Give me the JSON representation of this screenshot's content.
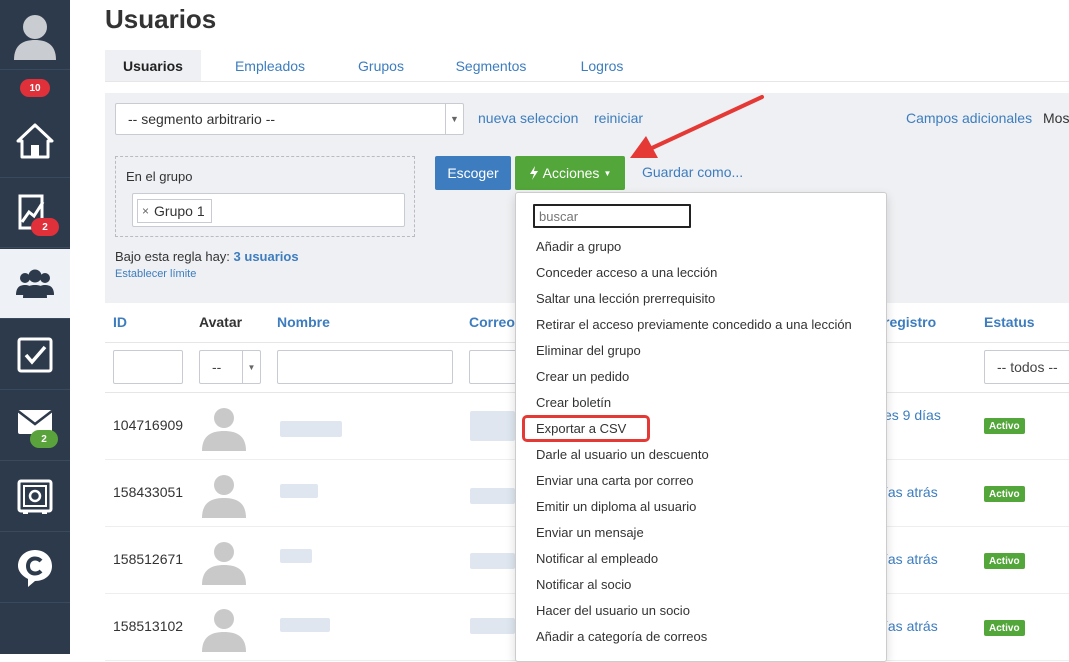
{
  "sidebar": {
    "badges": {
      "notifications": "10",
      "stats": "2",
      "mail": "2"
    }
  },
  "page": {
    "title": "Usuarios"
  },
  "tabs": [
    "Usuarios",
    "Empleados",
    "Grupos",
    "Segmentos",
    "Logros"
  ],
  "filters": {
    "segment_select": "-- segmento arbitrario --",
    "new_selection": "nueva seleccion",
    "reset": "reiniciar",
    "extra_fields": "Campos adicionales",
    "show_more": "Mos",
    "group_label": "En el grupo",
    "group_chip": "Grupo 1",
    "rule_prefix": "Bajo esta regla hay:",
    "rule_count": "3 usuarios",
    "set_limit": "Establecer límite",
    "choose_button": "Escoger",
    "actions_button": "Acciones",
    "save_as": "Guardar como..."
  },
  "table": {
    "headers": {
      "id": "ID",
      "avatar": "Avatar",
      "name": "Nombre",
      "email": "Correo",
      "registered": "registro",
      "status": "Estatus"
    },
    "filter_avatar": "--",
    "filter_status": "-- todos --",
    "rows": [
      {
        "id": "104716909",
        "date": "es 9 días",
        "status": "Activo"
      },
      {
        "id": "158433051",
        "date": "ías atrás",
        "status": "Activo"
      },
      {
        "id": "158512671",
        "date": "ías atrás",
        "status": "Activo"
      },
      {
        "id": "158513102",
        "date": "ías atrás",
        "status": "Activo"
      }
    ]
  },
  "dropdown": {
    "search_placeholder": "buscar",
    "items": [
      "Añadir a grupo",
      "Conceder acceso a una lección",
      "Saltar una lección prerrequisito",
      "Retirar el acceso previamente concedido a una lección",
      "Eliminar del grupo",
      "Crear un pedido",
      "Crear boletín",
      "Exportar a CSV",
      "Darle al usuario un descuento",
      "Enviar una carta por correo",
      "Emitir un diploma al usuario",
      "Enviar un mensaje",
      "Notificar al empleado",
      "Notificar al socio",
      "Hacer del usuario un socio",
      "Añadir a categoría de correos"
    ]
  },
  "colors": {
    "sidebar": "#2d3a4b",
    "link": "#3d7dbf",
    "primary": "#3d7dbf",
    "success": "#53a63a",
    "danger": "#e53935"
  }
}
